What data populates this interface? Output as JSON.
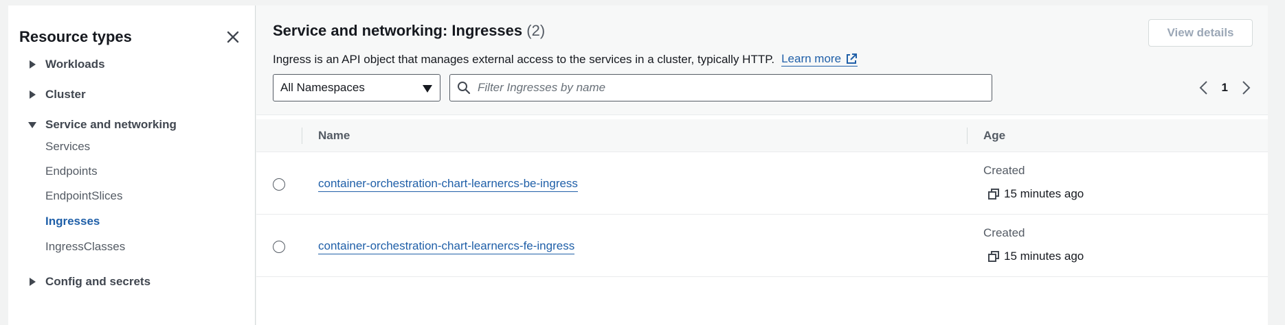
{
  "sidebar": {
    "title": "Resource types",
    "sections": [
      {
        "label": "Workloads",
        "expanded": false
      },
      {
        "label": "Cluster",
        "expanded": false
      },
      {
        "label": "Service and networking",
        "expanded": true
      },
      {
        "label": "Config and secrets",
        "expanded": false
      }
    ],
    "sub_items": [
      {
        "label": "Services",
        "active": false
      },
      {
        "label": "Endpoints",
        "active": false
      },
      {
        "label": "EndpointSlices",
        "active": false
      },
      {
        "label": "Ingresses",
        "active": true
      },
      {
        "label": "IngressClasses",
        "active": false
      }
    ]
  },
  "main": {
    "title": "Service and networking: Ingresses",
    "count": "(2)",
    "description": "Ingress is an API object that manages external access to the services in a cluster, typically HTTP.",
    "learn_more": "Learn more",
    "view_details_label": "View details",
    "namespace_select": "All Namespaces",
    "search_placeholder": "Filter Ingresses by name",
    "page_number": "1"
  },
  "table": {
    "columns": [
      "Name",
      "Age"
    ],
    "rows": [
      {
        "name": "container-orchestration-chart-learnercs-be-ingress",
        "created_label": "Created",
        "age": "15 minutes ago"
      },
      {
        "name": "container-orchestration-chart-learnercs-fe-ingress",
        "created_label": "Created",
        "age": "15 minutes ago"
      }
    ]
  },
  "colors": {
    "link": "#1f5fa8",
    "text": "#16191f",
    "muted": "#545b64",
    "disabled": "#9ba7b6",
    "background": "#f2f3f3"
  },
  "icons": [
    "close-icon",
    "caret-right-icon",
    "caret-down-icon",
    "external-link-icon",
    "dropdown-icon",
    "search-icon",
    "chevron-left-icon",
    "chevron-right-icon",
    "copy-icon"
  ]
}
